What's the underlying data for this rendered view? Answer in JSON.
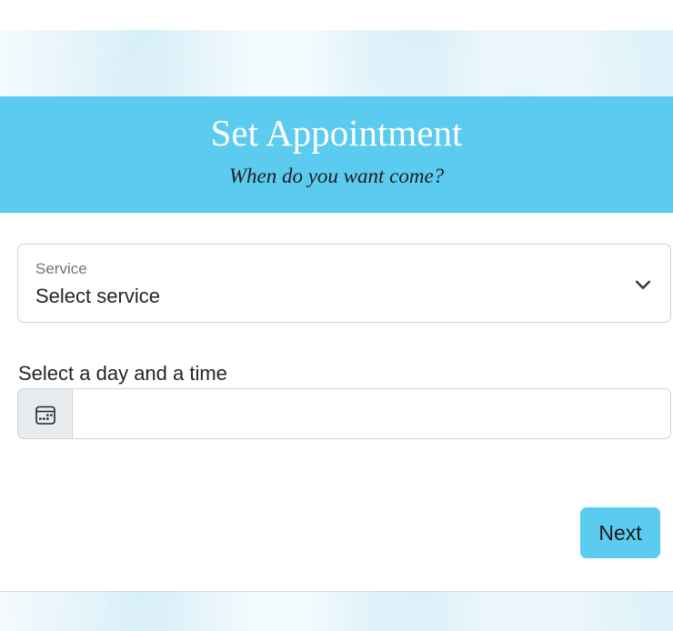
{
  "header": {
    "title": "Set Appointment",
    "subtitle": "When do you want come?"
  },
  "form": {
    "service": {
      "label": "Service",
      "selected_value": "Select service"
    },
    "datetime": {
      "label": "Select a day and a time",
      "value": ""
    },
    "next_label": "Next"
  },
  "icons": {
    "select_chevron": "chevron-down-icon",
    "calendar": "calendar-icon"
  },
  "colors": {
    "accent": "#5bcbf0",
    "header_title": "#ffffff",
    "border": "#ced4da",
    "addon_bg": "#e9ecef"
  }
}
